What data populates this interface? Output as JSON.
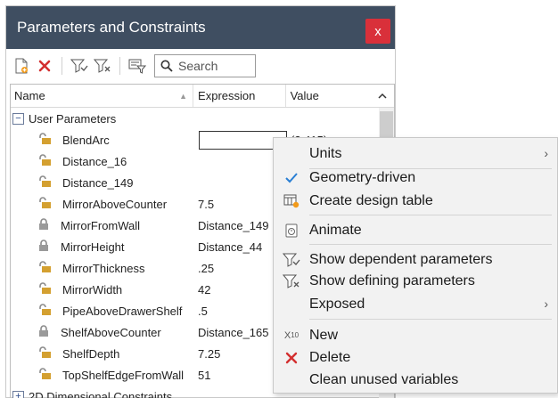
{
  "window": {
    "title": "Parameters and Constraints",
    "close_label": "x"
  },
  "toolbar": {
    "search_placeholder": "Search",
    "icons": [
      "new-parameter-icon",
      "delete-icon",
      "show-dependent-filter-icon",
      "show-defining-filter-icon",
      "filter-settings-icon",
      "search-icon"
    ]
  },
  "table": {
    "columns": {
      "name": "Name",
      "expression": "Expression",
      "value": "Value"
    },
    "groups": [
      {
        "label": "User Parameters",
        "expander": "−"
      },
      {
        "label": "2D Dimensional Constraints",
        "expander": "+"
      }
    ],
    "rows": [
      {
        "name": "BlendArc",
        "expression": "",
        "value": "(2.415)",
        "icon": "parameter-unlocked-icon",
        "editing": true
      },
      {
        "name": "Distance_16",
        "expression": "",
        "value": "",
        "icon": "parameter-unlocked-icon"
      },
      {
        "name": "Distance_149",
        "expression": "",
        "value": "",
        "icon": "parameter-unlocked-icon"
      },
      {
        "name": "MirrorAboveCounter",
        "expression": "7.5",
        "value": "",
        "icon": "parameter-unlocked-icon"
      },
      {
        "name": "MirrorFromWall",
        "expression": "Distance_149",
        "value": "",
        "icon": "parameter-locked-icon"
      },
      {
        "name": "MirrorHeight",
        "expression": "Distance_44",
        "value": "",
        "icon": "parameter-locked-icon"
      },
      {
        "name": "MirrorThickness",
        "expression": ".25",
        "value": "",
        "icon": "parameter-unlocked-icon"
      },
      {
        "name": "MirrorWidth",
        "expression": "42",
        "value": "",
        "icon": "parameter-unlocked-icon"
      },
      {
        "name": "PipeAboveDrawerShelf",
        "expression": ".5",
        "value": "",
        "icon": "parameter-unlocked-icon"
      },
      {
        "name": "ShelfAboveCounter",
        "expression": "Distance_165",
        "value": "",
        "icon": "parameter-locked-icon"
      },
      {
        "name": "ShelfDepth",
        "expression": "7.25",
        "value": "",
        "icon": "parameter-unlocked-icon"
      },
      {
        "name": "TopShelfEdgeFromWall",
        "expression": "51",
        "value": "",
        "icon": "parameter-unlocked-icon"
      }
    ]
  },
  "context_menu": {
    "items": [
      {
        "label": "Units",
        "icon": "",
        "submenu": true
      },
      {
        "label": "Geometry-driven",
        "icon": "checkmark-icon",
        "submenu": false
      },
      {
        "label": "Create design table",
        "icon": "design-table-icon",
        "submenu": false
      },
      {
        "label": "Animate",
        "icon": "animate-icon",
        "submenu": false
      },
      {
        "label": "Show dependent parameters",
        "icon": "filter-dependent-icon",
        "submenu": false
      },
      {
        "label": "Show defining parameters",
        "icon": "filter-defining-icon",
        "submenu": false
      },
      {
        "label": "Exposed",
        "icon": "",
        "submenu": true
      },
      {
        "label": "New",
        "icon": "new-variable-icon",
        "submenu": false
      },
      {
        "label": "Delete",
        "icon": "delete-icon",
        "submenu": false
      },
      {
        "label": "Clean unused variables",
        "icon": "",
        "submenu": false
      }
    ],
    "new_icon_text": {
      "top": "X",
      "sub": "10"
    }
  },
  "colors": {
    "titlebar": "#3f4e61",
    "close_button": "#d9303a",
    "delete_red": "#d32f2f",
    "check_blue": "#2a7fd4",
    "menu_bg": "#f2f2f2"
  }
}
